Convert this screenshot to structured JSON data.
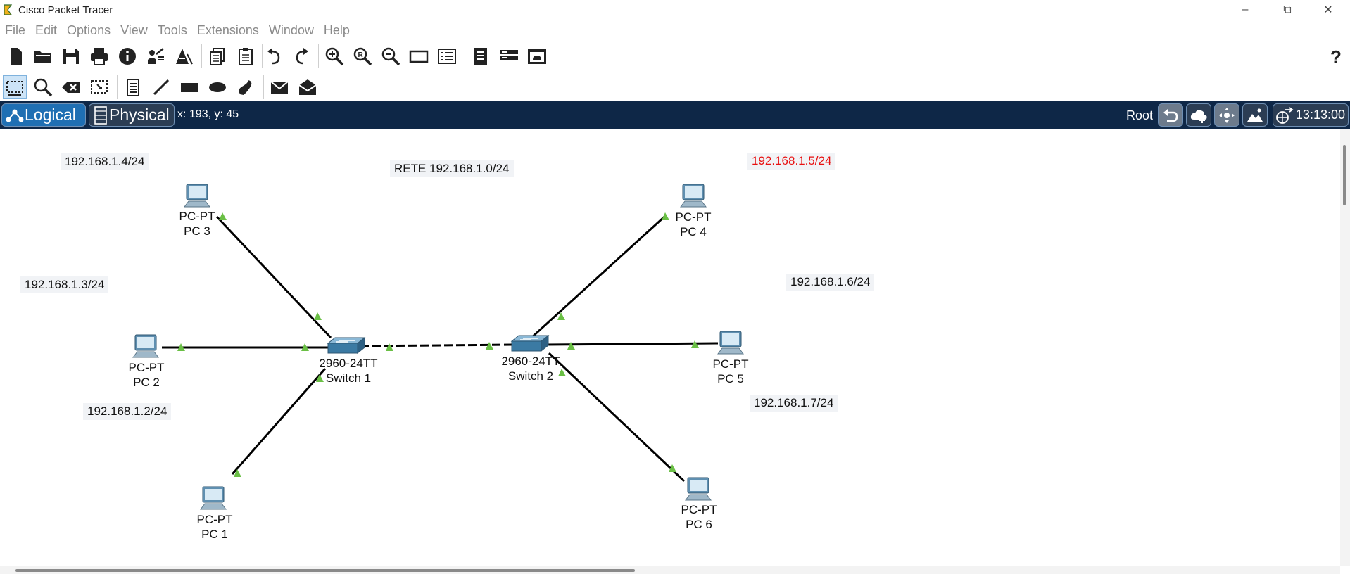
{
  "window": {
    "title": "Cisco Packet Tracer"
  },
  "menu": [
    "File",
    "Edit",
    "Options",
    "View",
    "Tools",
    "Extensions",
    "Window",
    "Help"
  ],
  "toolbar1_icons": [
    "new-file-icon",
    "open-folder-icon",
    "save-icon",
    "print-icon",
    "info-icon",
    "activity-wizard-icon",
    "custom-device-icon",
    "copy-icon",
    "paste-icon",
    "undo-icon",
    "redo-icon",
    "zoom-in-icon",
    "zoom-reset-icon",
    "zoom-out-icon",
    "drawing-palette-icon",
    "custom-devices-dialog-icon",
    "pdu-list-icon",
    "network-controller-icon",
    "screenshot-icon"
  ],
  "toolbar2_icons": [
    "select-icon",
    "inspect-icon",
    "delete-icon",
    "resize-icon",
    "note-icon",
    "line-icon",
    "rectangle-icon",
    "ellipse-icon",
    "freeform-icon",
    "add-simple-pdu-icon",
    "add-complex-pdu-icon"
  ],
  "modebar": {
    "logical_label": "Logical",
    "physical_label": "Physical",
    "coords": "x: 193, y: 45",
    "root_label": "Root",
    "clock": "13:13:00"
  },
  "notes": {
    "network": "RETE 192.168.1.0/24",
    "pc3_ip": "192.168.1.4/24",
    "pc4_ip": "192.168.1.5/24",
    "pc2_ip": "192.168.1.3/24",
    "pc5_ip": "192.168.1.6/24",
    "pc1_ip": "192.168.1.2/24",
    "pc6_ip": "192.168.1.7/24"
  },
  "devices": {
    "pc1": {
      "model": "PC-PT",
      "name": "PC 1"
    },
    "pc2": {
      "model": "PC-PT",
      "name": "PC 2"
    },
    "pc3": {
      "model": "PC-PT",
      "name": "PC 3"
    },
    "pc4": {
      "model": "PC-PT",
      "name": "PC 4"
    },
    "pc5": {
      "model": "PC-PT",
      "name": "PC 5"
    },
    "pc6": {
      "model": "PC-PT",
      "name": "PC 6"
    },
    "sw1": {
      "model": "2960-24TT",
      "name": "Switch 1"
    },
    "sw2": {
      "model": "2960-24TT",
      "name": "Switch 2"
    }
  },
  "colors": {
    "modebar": "#0e2747",
    "link_up": "#6abf45",
    "ip_highlight": "#e81010"
  }
}
